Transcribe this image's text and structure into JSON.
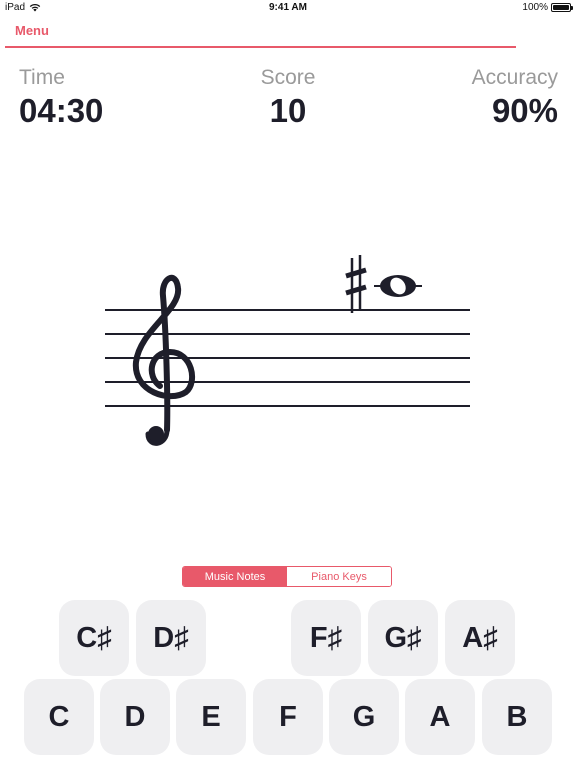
{
  "status_bar": {
    "device": "iPad",
    "time": "9:41 AM",
    "battery": "100%"
  },
  "nav": {
    "menu_label": "Menu",
    "accent_color": "#e8596a"
  },
  "stats": {
    "time": {
      "label": "Time",
      "value": "04:30"
    },
    "score": {
      "label": "Score",
      "value": "10"
    },
    "accuracy": {
      "label": "Accuracy",
      "value": "90%"
    }
  },
  "staff": {
    "clef": "treble",
    "accidental": "sharp",
    "accidental_glyph": "♯",
    "note": "whole",
    "note_position": "ledger line above staff"
  },
  "mode_toggle": {
    "options": [
      "Music Notes",
      "Piano Keys"
    ],
    "selected": "Music Notes"
  },
  "keys": {
    "sharps": [
      "C♯",
      "D♯",
      "F♯",
      "G♯",
      "A♯"
    ],
    "naturals": [
      "C",
      "D",
      "E",
      "F",
      "G",
      "A",
      "B"
    ]
  }
}
